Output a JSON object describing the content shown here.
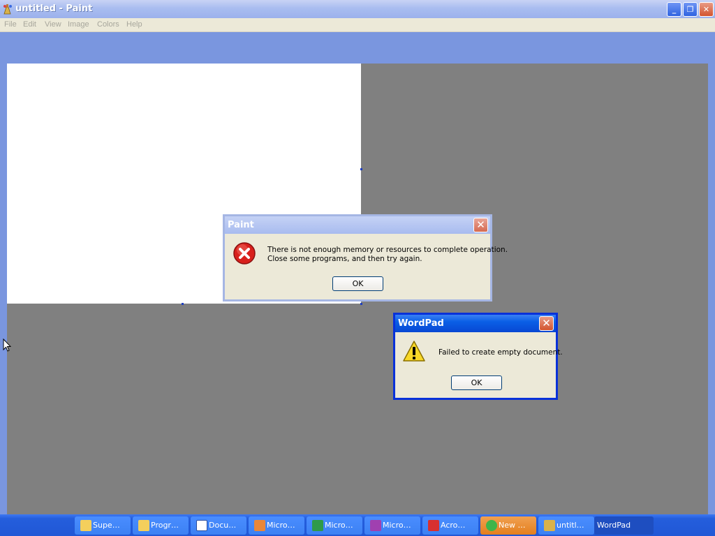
{
  "window": {
    "title": "untitled - Paint"
  },
  "menu": [
    "File",
    "Edit",
    "View",
    "Image",
    "Colors",
    "Help"
  ],
  "caption_buttons": {
    "minimize": "_",
    "restore": "❐",
    "close": "✕"
  },
  "dialogs": {
    "paint": {
      "title": "Paint",
      "line1": "There is not enough memory or resources to complete operation.",
      "line2": "Close some programs, and then try again.",
      "ok": "OK"
    },
    "wordpad": {
      "title": "WordPad",
      "message": "Failed to create empty document.",
      "ok": "OK"
    }
  },
  "taskbar": {
    "items": [
      {
        "label": "Supe…",
        "icon": "folder-icon"
      },
      {
        "label": "Progr…",
        "icon": "folder-icon"
      },
      {
        "label": "Docu…",
        "icon": "word-icon"
      },
      {
        "label": "Micro…",
        "icon": "powerpoint-icon"
      },
      {
        "label": "Micro…",
        "icon": "excel-icon"
      },
      {
        "label": "Micro…",
        "icon": "onenote-icon"
      },
      {
        "label": "Acro…",
        "icon": "acrobat-icon"
      },
      {
        "label": "New …",
        "icon": "messenger-icon"
      },
      {
        "label": "untitl…",
        "icon": "paint-icon"
      },
      {
        "label": "WordPad",
        "icon": ""
      }
    ]
  },
  "colors": {
    "titlebar_inactive": "#a9bdf0",
    "titlebar_active": "#0a5fe6",
    "workspace": "#808080",
    "desktop_blue": "#7a96df"
  }
}
